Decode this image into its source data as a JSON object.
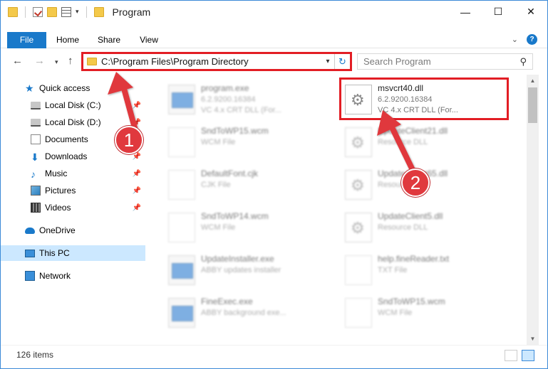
{
  "window": {
    "title": "Program",
    "controls": {
      "minimize": "—",
      "maximize": "☐",
      "close": "✕"
    }
  },
  "ribbon": {
    "tabs": [
      "File",
      "Home",
      "Share",
      "View"
    ],
    "expand_icon": "chevron-down-icon",
    "help_label": "?"
  },
  "address": {
    "path": "C:\\Program Files\\Program Directory",
    "search_placeholder": "Search Program"
  },
  "nav": {
    "items": [
      {
        "label": "Quick access",
        "icon": "star-icon",
        "pinned": false
      },
      {
        "label": "Local Disk (C:)",
        "icon": "disk-icon",
        "pinned": true
      },
      {
        "label": "Local Disk (D:)",
        "icon": "disk-icon",
        "pinned": true
      },
      {
        "label": "Documents",
        "icon": "documents-icon",
        "pinned": true
      },
      {
        "label": "Downloads",
        "icon": "download-icon",
        "pinned": true
      },
      {
        "label": "Music",
        "icon": "music-icon",
        "pinned": true
      },
      {
        "label": "Pictures",
        "icon": "pictures-icon",
        "pinned": true
      },
      {
        "label": "Videos",
        "icon": "videos-icon",
        "pinned": true
      },
      {
        "label": "OneDrive",
        "icon": "cloud-icon",
        "pinned": false
      },
      {
        "label": "This PC",
        "icon": "computer-icon",
        "pinned": false,
        "selected": true
      },
      {
        "label": "Network",
        "icon": "network-icon",
        "pinned": false
      }
    ]
  },
  "files": [
    {
      "name": "program.exe",
      "line1": "6.2.9200.16384",
      "line2": "VC 4.x CRT DLL (For...",
      "icon": "exe-icon",
      "blurred": true
    },
    {
      "name": "msvcrt40.dll",
      "line1": "6.2.9200.16384",
      "line2": "VC 4.x CRT DLL (For...",
      "icon": "dll-icon",
      "blurred": false,
      "highlighted": true
    },
    {
      "name": "SndToWP15.wcm",
      "line1": "WCM File",
      "icon": "document-icon",
      "blurred": true
    },
    {
      "name": "UpdateClient21.dll",
      "line1": "Resource DLL",
      "icon": "dll-icon",
      "blurred": true
    },
    {
      "name": "DefaultFont.cjk",
      "line1": "CJK File",
      "icon": "document-icon",
      "blurred": true
    },
    {
      "name": "UpdateClient65.dll",
      "line1": "Resource DLL",
      "icon": "dll-icon",
      "blurred": true
    },
    {
      "name": "SndToWP14.wcm",
      "line1": "WCM File",
      "icon": "document-icon",
      "blurred": true
    },
    {
      "name": "UpdateClient5.dll",
      "line1": "Resource DLL",
      "icon": "dll-icon",
      "blurred": true
    },
    {
      "name": "UpdateInstaller.exe",
      "line1": "ABBY updates installer",
      "icon": "exe-icon",
      "blurred": true
    },
    {
      "name": "help.fineReader.txt",
      "line1": "TXT File",
      "icon": "document-icon",
      "blurred": true
    },
    {
      "name": "FineExec.exe",
      "line1": "ABBY background exe...",
      "icon": "exe-icon",
      "blurred": true
    },
    {
      "name": "SndToWP15.wcm",
      "line1": "WCM File",
      "icon": "document-icon",
      "blurred": true
    }
  ],
  "status": {
    "item_count": "126 items"
  },
  "annotations": {
    "badge1": "1",
    "badge2": "2",
    "color": "#e0393e"
  },
  "colors": {
    "accent": "#1979ca",
    "highlight": "#e21d24",
    "selected_bg": "#cce8ff"
  }
}
